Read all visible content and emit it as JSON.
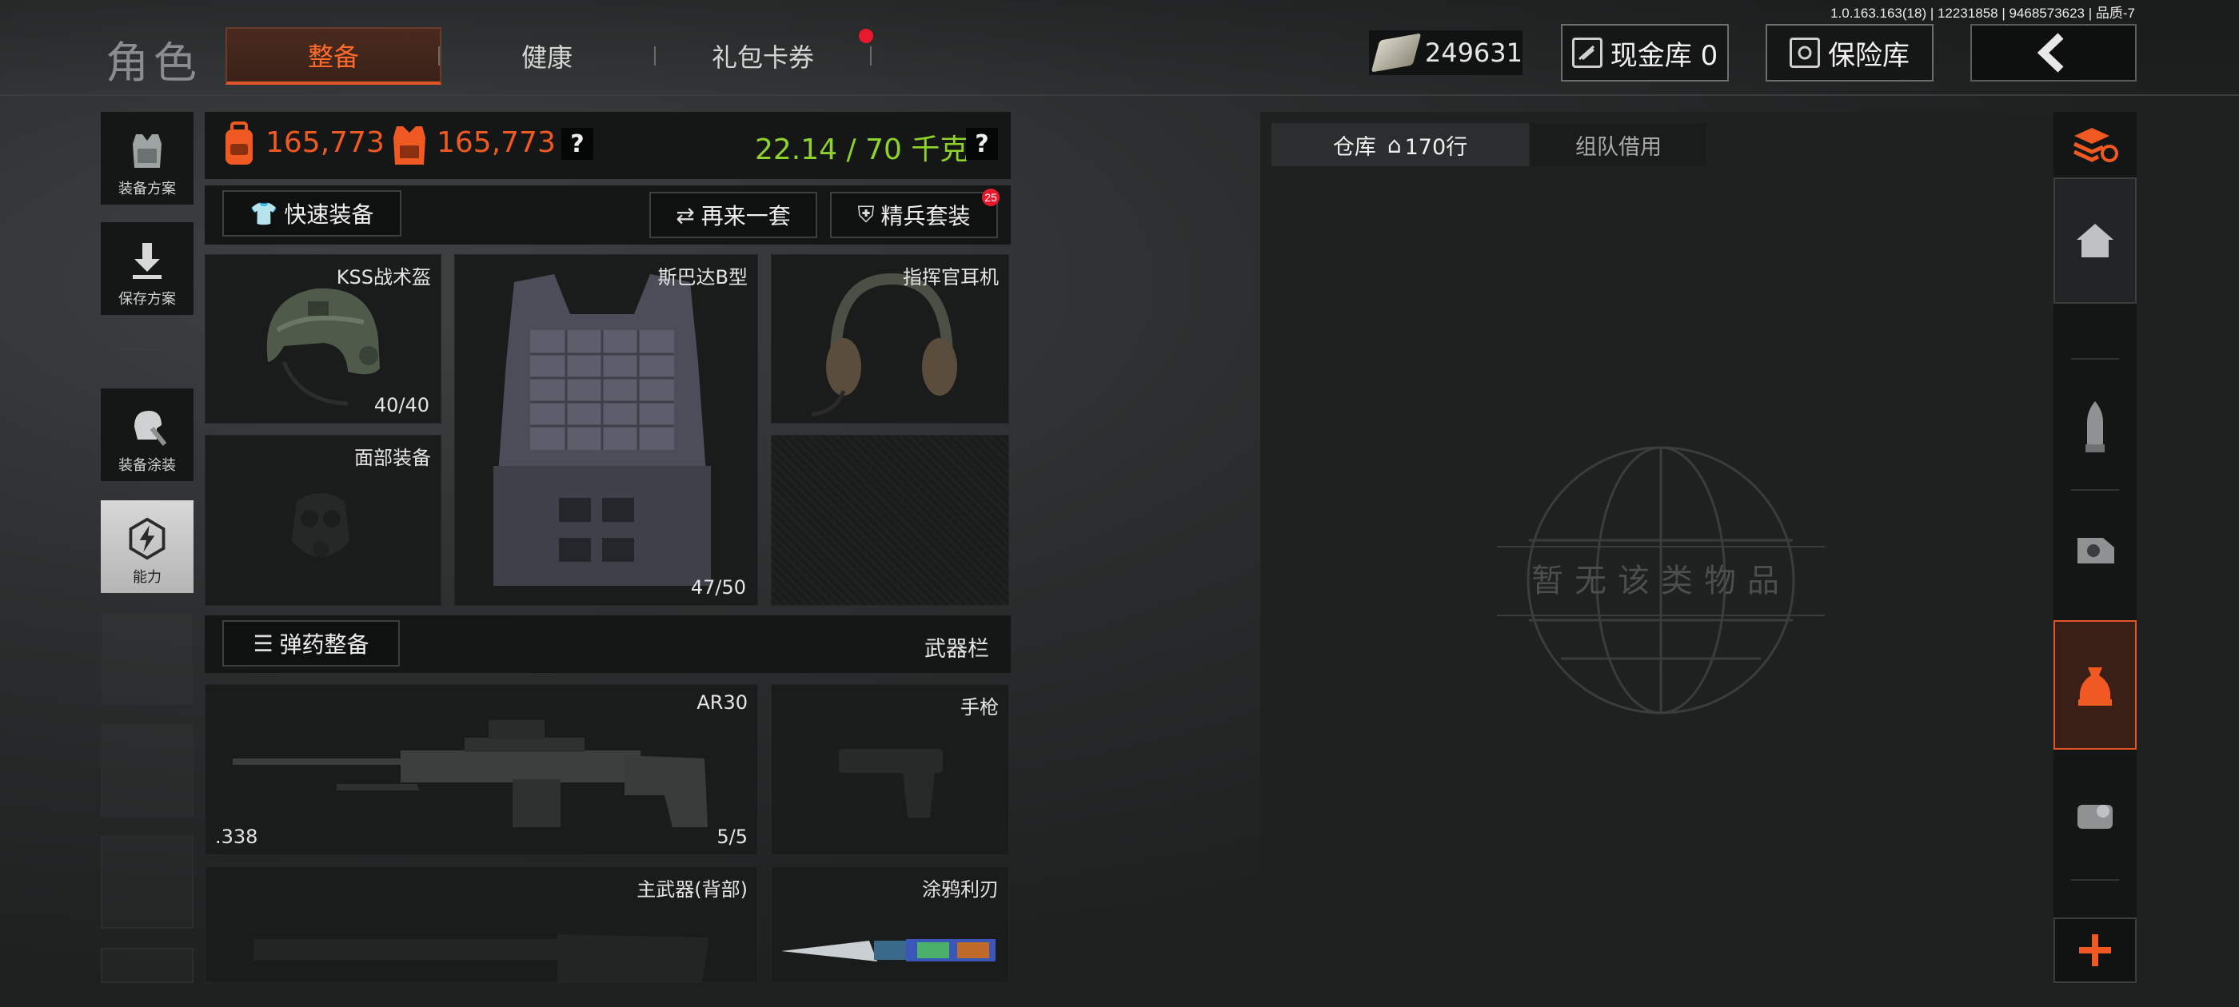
{
  "version_info": "1.0.163.163(18) | 12231858 | 9468573623 | 品质-7",
  "page_title": "角色",
  "tabs": [
    {
      "label": "整备",
      "active": true
    },
    {
      "label": "健康",
      "active": false
    },
    {
      "label": "礼包卡券",
      "active": false
    }
  ],
  "currency": {
    "amount": "249631",
    "icon": "cash-icon"
  },
  "top_buttons": {
    "cash_vault": "现金库 0",
    "safe_box": "保险库"
  },
  "sidebar": {
    "items": [
      {
        "label": "装备方案",
        "icon": "vest-icon"
      },
      {
        "label": "保存方案",
        "icon": "download-icon"
      },
      {
        "label": "装备涂装",
        "icon": "paint-icon"
      },
      {
        "label": "能力",
        "icon": "lightning-icon",
        "active": true
      }
    ]
  },
  "stats": {
    "value_backpack": "165,773",
    "value_armor": "165,773",
    "weight": "22.14 / 70 千克",
    "help": "?"
  },
  "actions": {
    "quick_equip": "快速装备",
    "again": "再来一套",
    "elite_set": "精兵套装",
    "elite_badge": "25"
  },
  "gear": {
    "helmet": {
      "name": "KSS战术盔",
      "durability": "40/40"
    },
    "armor": {
      "name": "斯巴达B型",
      "durability": "47/50"
    },
    "headset": {
      "name": "指挥官耳机"
    },
    "face": {
      "name": "面部装备"
    }
  },
  "ammo_button": "弹药整备",
  "weapon_bar_label": "武器栏",
  "weapons": {
    "primary": {
      "name": "AR30",
      "caliber": ".338",
      "ammo": "5/5"
    },
    "pistol": {
      "name": "手枪"
    },
    "back": {
      "name": "主武器(背部)"
    },
    "melee": {
      "name": "涂鸦利刃"
    }
  },
  "warehouse": {
    "tab_storage": "仓库",
    "storage_rows": "170行",
    "tab_team": "组队借用",
    "empty_text": "暂无该类物品"
  },
  "colors": {
    "accent": "#f05a22",
    "weight_green": "#8ed22b"
  }
}
